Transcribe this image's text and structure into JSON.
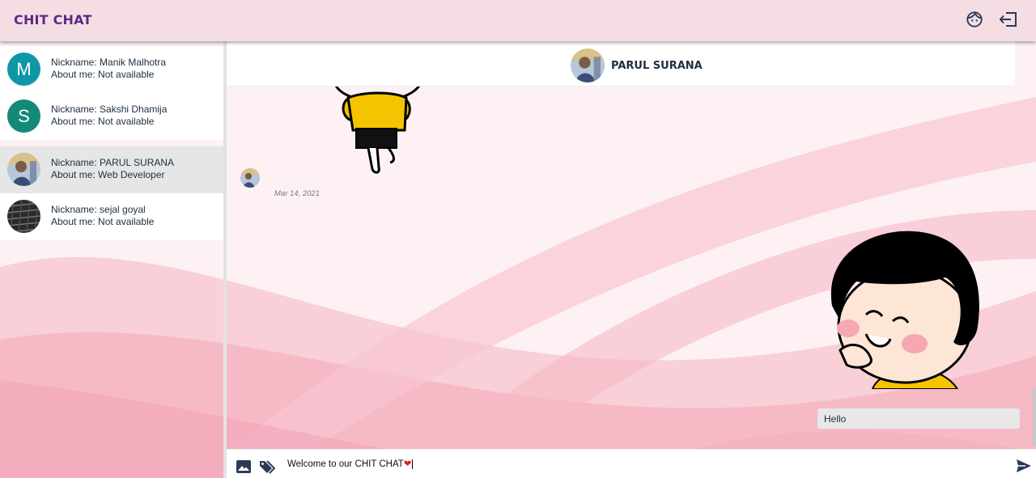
{
  "header": {
    "app_title": "CHIT CHAT",
    "profile_icon": "face-icon",
    "logout_icon": "logout-icon"
  },
  "contacts": [
    {
      "avatar_letter": "M",
      "avatar_color": "#0f97a8",
      "nickname": "Nickname: Manik Malhotra",
      "about": "About me: Not available",
      "active": false
    },
    {
      "avatar_letter": "S",
      "avatar_color": "#138a78",
      "nickname": "Nickname: Sakshi Dhamija",
      "about": "About me: Not available",
      "active": false
    },
    {
      "avatar_letter": "",
      "avatar_color": "#8aa0b8",
      "nickname": "Nickname: PARUL SURANA",
      "about": "About me: Web Developer",
      "active": true
    },
    {
      "avatar_letter": "",
      "avatar_color": "#444444",
      "nickname": "Nickname: sejal goyal",
      "about": "About me: Not available",
      "active": false
    }
  ],
  "chat": {
    "peer_name": "PARUL SURANA",
    "messages": [
      {
        "type": "sticker",
        "side": "incoming",
        "description": "boy-sticker"
      },
      {
        "type": "meta",
        "date": "Mar 14, 2021"
      },
      {
        "type": "sticker",
        "side": "outgoing",
        "description": "girl-sticker"
      },
      {
        "type": "text",
        "side": "outgoing",
        "text": "Hello"
      }
    ]
  },
  "composer": {
    "value_text": "Welcome to our CHIT CHAT",
    "value_emoji": "❤",
    "image_icon": "image-icon",
    "sticker_icon": "tag-icon",
    "send_icon": "send-icon"
  },
  "colors": {
    "accent": "#5b2a86",
    "header_bg": "#f5dde4",
    "bg_pink": "#f7b8c4",
    "active_row": "#e6e6e6",
    "text_dark": "#203040"
  }
}
